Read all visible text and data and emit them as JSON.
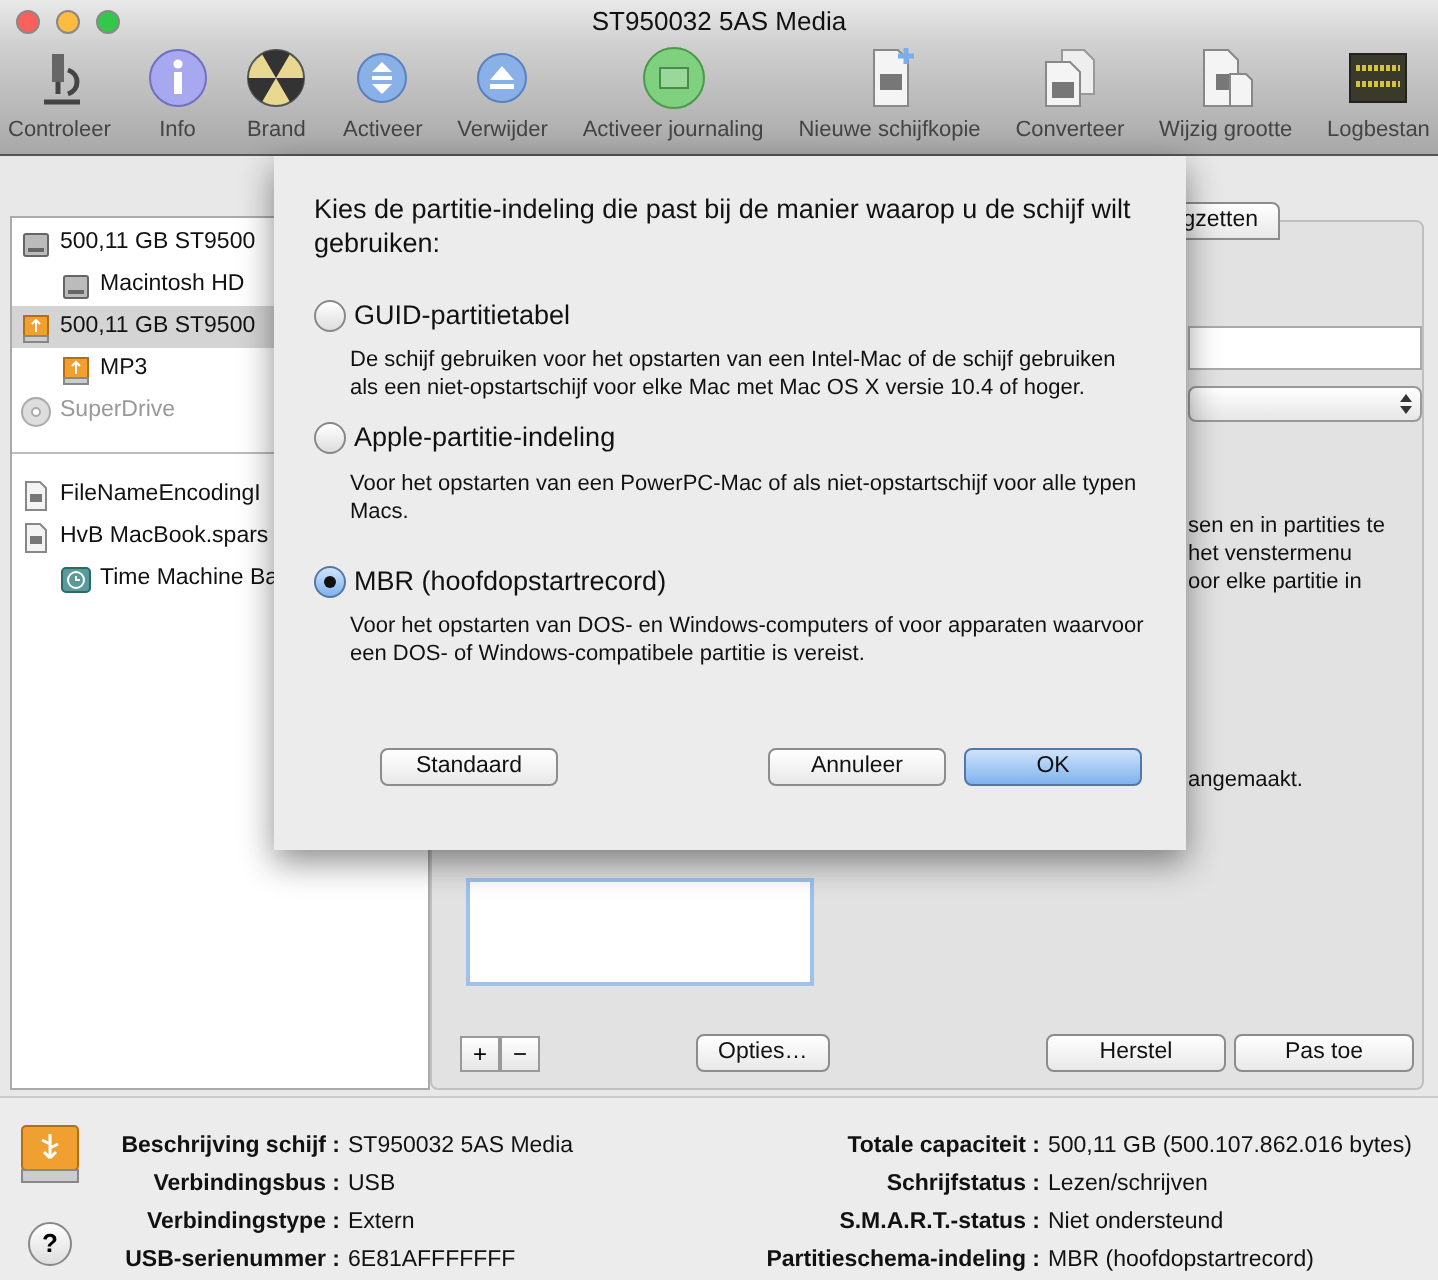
{
  "window": {
    "title": "ST950032 5AS Media"
  },
  "toolbar": [
    {
      "label": "Controleer",
      "kind": "microscope"
    },
    {
      "label": "Info",
      "kind": "info"
    },
    {
      "label": "Brand",
      "kind": "burn"
    },
    {
      "label": "Activeer",
      "kind": "mount"
    },
    {
      "label": "Verwijder",
      "kind": "eject"
    },
    {
      "label": "Activeer journaling",
      "kind": "journal"
    },
    {
      "label": "Nieuwe schijfkopie",
      "kind": "newimage"
    },
    {
      "label": "Converteer",
      "kind": "convert"
    },
    {
      "label": "Wijzig grootte",
      "kind": "resize"
    },
    {
      "label": "Logbestan",
      "kind": "log"
    }
  ],
  "sidebar": {
    "devices": [
      {
        "label": "500,11 GB ST9500",
        "kind": "hdd",
        "selected": false,
        "disabled": false,
        "children": [
          {
            "label": "Macintosh HD",
            "kind": "hdd",
            "selected": false,
            "disabled": false
          }
        ]
      },
      {
        "label": "500,11 GB ST9500",
        "kind": "usb",
        "selected": true,
        "disabled": false,
        "children": [
          {
            "label": "MP3",
            "kind": "usb",
            "selected": false,
            "disabled": false
          }
        ]
      },
      {
        "label": "SuperDrive",
        "kind": "optical",
        "selected": false,
        "disabled": true
      }
    ],
    "images": [
      {
        "label": "FileNameEncodingI",
        "kind": "image",
        "selected": false,
        "disabled": false
      },
      {
        "label": "HvB MacBook.spars",
        "kind": "image",
        "selected": false,
        "disabled": false,
        "children": [
          {
            "label": "Time Machine Ba",
            "kind": "timemachine",
            "selected": false,
            "disabled": false
          }
        ]
      }
    ]
  },
  "panel": {
    "tab_fragment": "gzetten",
    "text_fragments": [
      "sen en in partities te",
      "het venstermenu",
      "oor elke partitie in"
    ],
    "status_fragment": "angemaakt.",
    "add": "+",
    "remove": "−",
    "buttons": [
      "Opties…",
      "Herstel",
      "Pas toe"
    ]
  },
  "sheet": {
    "prompt": "Kies de partitie-indeling die past bij de manier waarop u de schijf wilt gebruiken:",
    "options": [
      {
        "label": "GUID-partitietabel",
        "description": "De schijf gebruiken voor het opstarten van een Intel-Mac of de schijf gebruiken als een niet-opstartschijf voor elke Mac met Mac OS X versie 10.4 of hoger.",
        "selected": false
      },
      {
        "label": "Apple-partitie-indeling",
        "description": "Voor het opstarten van een PowerPC-Mac of als niet-opstartschijf voor alle typen Macs.",
        "selected": false
      },
      {
        "label": "MBR (hoofdopstartrecord)",
        "description": "Voor het opstarten van DOS- en Windows-computers of voor apparaten waarvoor een DOS- of Windows-compatibele partitie is vereist.",
        "selected": true
      }
    ],
    "buttons": [
      {
        "label": "Standaard",
        "default": false
      },
      {
        "label": "Annuleer",
        "default": false
      },
      {
        "label": "OK",
        "default": true
      }
    ]
  },
  "info": {
    "left": [
      {
        "label": "Beschrijving schijf :",
        "value": "ST950032 5AS Media"
      },
      {
        "label": "Verbindingsbus :",
        "value": "USB"
      },
      {
        "label": "Verbindingstype :",
        "value": "Extern"
      },
      {
        "label": "USB-serienummer :",
        "value": "6E81AFFFFFFF"
      }
    ],
    "right": [
      {
        "label": "Totale capaciteit :",
        "value": "500,11 GB (500.107.862.016 bytes)"
      },
      {
        "label": "Schrijfstatus :",
        "value": "Lezen/schrijven"
      },
      {
        "label": "S.M.A.R.T.-status :",
        "value": "Niet ondersteund"
      },
      {
        "label": "Partitieschema-indeling :",
        "value": "MBR (hoofdopstartrecord)"
      }
    ],
    "help": "?"
  }
}
